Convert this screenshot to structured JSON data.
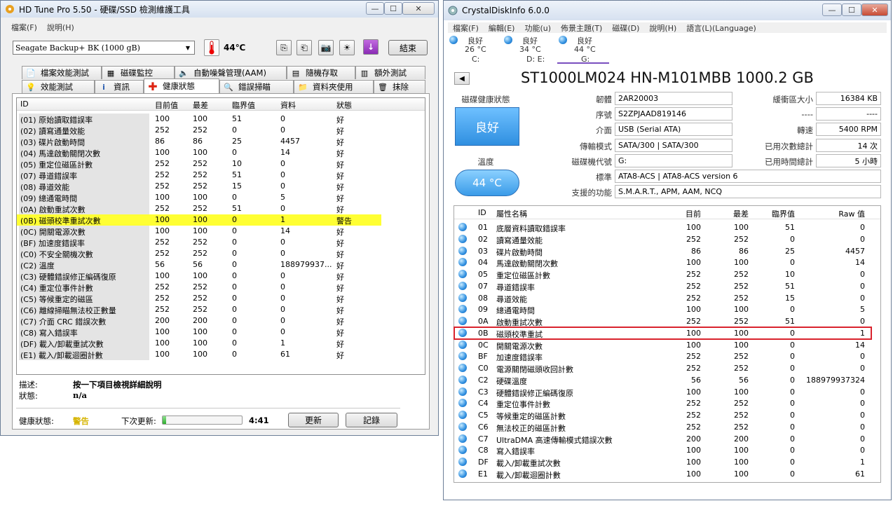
{
  "hdtune": {
    "title": "HD Tune Pro 5.50 - 硬碟/SSD 檢測維護工具",
    "menu": [
      "檔案(F)",
      "說明(H)"
    ],
    "drive": "Seagate Backup+ BK (1000 gB)",
    "temp": "44℃",
    "exit_label": "結束",
    "tabs_row1": [
      "檔案效能測試",
      "磁碟監控",
      "自動噪聲管理(AAM)",
      "隨機存取",
      "額外測試"
    ],
    "tabs_row2": [
      "效能測試",
      "資訊",
      "健康狀態",
      "錯誤掃瞄",
      "資料夾使用",
      "抹除"
    ],
    "columns": [
      "ID",
      "目前值",
      "最差",
      "臨界值",
      "資料",
      "狀態"
    ],
    "rows": [
      [
        "(01) 原始讀取錯誤率",
        "100",
        "100",
        "51",
        "0",
        "好"
      ],
      [
        "(02) 讀寫通量效能",
        "252",
        "252",
        "0",
        "0",
        "好"
      ],
      [
        "(03) 碟片啟動時間",
        "86",
        "86",
        "25",
        "4457",
        "好"
      ],
      [
        "(04) 馬達啟動關閉次數",
        "100",
        "100",
        "0",
        "14",
        "好"
      ],
      [
        "(05) 重定位磁區計數",
        "252",
        "252",
        "10",
        "0",
        "好"
      ],
      [
        "(07) 尋道錯誤率",
        "252",
        "252",
        "51",
        "0",
        "好"
      ],
      [
        "(08) 尋道效能",
        "252",
        "252",
        "15",
        "0",
        "好"
      ],
      [
        "(09) 總通電時間",
        "100",
        "100",
        "0",
        "5",
        "好"
      ],
      [
        "(0A) 啟動重試次數",
        "252",
        "252",
        "51",
        "0",
        "好"
      ],
      [
        "(0B) 磁頭校準重試次數",
        "100",
        "100",
        "0",
        "1",
        "警告"
      ],
      [
        "(0C) 開關電源次數",
        "100",
        "100",
        "0",
        "14",
        "好"
      ],
      [
        "(BF) 加速度錯誤率",
        "252",
        "252",
        "0",
        "0",
        "好"
      ],
      [
        "(C0) 不安全關機次數",
        "252",
        "252",
        "0",
        "0",
        "好"
      ],
      [
        "(C2) 溫度",
        "56",
        "56",
        "0",
        "188979937...",
        "好"
      ],
      [
        "(C3) 硬體錯誤修正編碼復原",
        "100",
        "100",
        "0",
        "0",
        "好"
      ],
      [
        "(C4) 重定位事件計數",
        "252",
        "252",
        "0",
        "0",
        "好"
      ],
      [
        "(C5) 等候重定的磁區",
        "252",
        "252",
        "0",
        "0",
        "好"
      ],
      [
        "(C6) 離線掃瞄無法校正數量",
        "252",
        "252",
        "0",
        "0",
        "好"
      ],
      [
        "(C7) 介面 CRC 錯誤次數",
        "200",
        "200",
        "0",
        "0",
        "好"
      ],
      [
        "(C8) 寫入錯誤率",
        "100",
        "100",
        "0",
        "0",
        "好"
      ],
      [
        "(DF) 載入/卸載重試次數",
        "100",
        "100",
        "0",
        "1",
        "好"
      ],
      [
        "(E1) 載入/卸載迴圈計數",
        "100",
        "100",
        "0",
        "61",
        "好"
      ]
    ],
    "desc_label": "描述:",
    "desc_value": "按一下項目檢視詳細說明",
    "status_label": "狀態:",
    "status_value": "n/a",
    "health_label": "健康狀態:",
    "health_value": "警告",
    "next_update_label": "下次更新:",
    "progress": 0.04,
    "countdown": "4:41",
    "refresh_label": "更新",
    "log_label": "記錄"
  },
  "crystal": {
    "title": "CrystalDiskInfo 6.0.0",
    "menu": [
      "檔案(F)",
      "編輯(E)",
      "功能(u)",
      "佈景主題(T)",
      "磁碟(D)",
      "說明(H)",
      "語言(L)(Language)"
    ],
    "disks": [
      {
        "status": "良好",
        "temp": "26 °C",
        "letter": "C:"
      },
      {
        "status": "良好",
        "temp": "34 °C",
        "letter": "D: E:"
      },
      {
        "status": "良好",
        "temp": "44 °C",
        "letter": "G:"
      }
    ],
    "model": "ST1000LM024 HN-M101MBB 1000.2 GB",
    "health_label": "磁碟健康狀態",
    "health_value": "良好",
    "temp_label": "溫度",
    "temp_value": "44 °C",
    "firmware_label": "韌體",
    "firmware": "2AR20003",
    "serial_label": "序號",
    "serial": "S2ZPJAAD819146",
    "interface_label": "介面",
    "interface": "USB (Serial ATA)",
    "transfer_label": "傳輸模式",
    "transfer": "SATA/300 | SATA/300",
    "letter_label": "磁碟機代號",
    "letter": "G:",
    "standard_label": "標準",
    "standard": "ATA8-ACS | ATA8-ACS version 6",
    "features_label": "支援的功能",
    "features": "S.M.A.R.T., APM, AAM, NCQ",
    "buffer_label": "緩衝區大小",
    "buffer": "16384 KB",
    "blank1_label": "----",
    "blank1": "----",
    "rpm_label": "轉速",
    "rpm": "5400 RPM",
    "poweron_count_label": "已用次數總計",
    "poweron_count": "14 次",
    "poweron_hours_label": "已用時間總計",
    "poweron_hours": "5 小時",
    "columns": [
      "ID",
      "屬性名稱",
      "目前",
      "最差",
      "臨界值",
      "Raw 值"
    ],
    "rows": [
      [
        "01",
        "底層資料讀取錯誤率",
        "100",
        "100",
        "51",
        "0"
      ],
      [
        "02",
        "讀寫通量效能",
        "252",
        "252",
        "0",
        "0"
      ],
      [
        "03",
        "碟片啟動時間",
        "86",
        "86",
        "25",
        "4457"
      ],
      [
        "04",
        "馬達啟動關閉次數",
        "100",
        "100",
        "0",
        "14"
      ],
      [
        "05",
        "重定位磁區計數",
        "252",
        "252",
        "10",
        "0"
      ],
      [
        "07",
        "尋道錯誤率",
        "252",
        "252",
        "51",
        "0"
      ],
      [
        "08",
        "尋道效能",
        "252",
        "252",
        "15",
        "0"
      ],
      [
        "09",
        "總通電時間",
        "100",
        "100",
        "0",
        "5"
      ],
      [
        "0A",
        "啟動重試次數",
        "252",
        "252",
        "51",
        "0"
      ],
      [
        "0B",
        "磁頭校準重試",
        "100",
        "100",
        "0",
        "1"
      ],
      [
        "0C",
        "開關電源次數",
        "100",
        "100",
        "0",
        "14"
      ],
      [
        "BF",
        "加速度錯誤率",
        "252",
        "252",
        "0",
        "0"
      ],
      [
        "C0",
        "電源關閉磁頭收回計數",
        "252",
        "252",
        "0",
        "0"
      ],
      [
        "C2",
        "硬碟溫度",
        "56",
        "56",
        "0",
        "188979937324"
      ],
      [
        "C3",
        "硬體錯誤修正編碼復原",
        "100",
        "100",
        "0",
        "0"
      ],
      [
        "C4",
        "重定位事件計數",
        "252",
        "252",
        "0",
        "0"
      ],
      [
        "C5",
        "等候重定的磁區計數",
        "252",
        "252",
        "0",
        "0"
      ],
      [
        "C6",
        "無法校正的磁區計數",
        "252",
        "252",
        "0",
        "0"
      ],
      [
        "C7",
        "UltraDMA 高速傳輸模式錯誤次數",
        "200",
        "200",
        "0",
        "0"
      ],
      [
        "C8",
        "寫入錯誤率",
        "100",
        "100",
        "0",
        "0"
      ],
      [
        "DF",
        "載入/卸載重試次數",
        "100",
        "100",
        "0",
        "1"
      ],
      [
        "E1",
        "載入/卸載迴圈計數",
        "100",
        "100",
        "0",
        "61"
      ]
    ],
    "colors": {
      "highlight": "#d9232d",
      "health": "#3d8edb",
      "warning": "#ffff33"
    }
  }
}
